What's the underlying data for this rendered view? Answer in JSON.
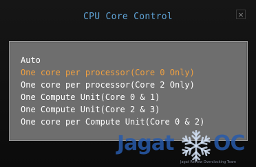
{
  "dialog": {
    "title": "CPU Core Control",
    "close_label": "×"
  },
  "options": [
    {
      "label": "Auto",
      "selected": false
    },
    {
      "label": "One core per processor(Core 0 Only)",
      "selected": true
    },
    {
      "label": "One core per processor(Core 2 Only)",
      "selected": false
    },
    {
      "label": "One Compute Unit(Core 0 & 1)",
      "selected": false
    },
    {
      "label": "One Compute Unit(Core 2 & 3)",
      "selected": false
    },
    {
      "label": "One core per Compute Unit(Core 0 & 2)",
      "selected": false
    }
  ],
  "watermark": {
    "left": "Jagat",
    "right": "OC",
    "tagline": "Jagat Review Overclocking Team"
  },
  "colors": {
    "title": "#5fa3d6",
    "selected_option": "#f0a040",
    "option": "#ffffff",
    "panel": "#6e6e6e"
  }
}
